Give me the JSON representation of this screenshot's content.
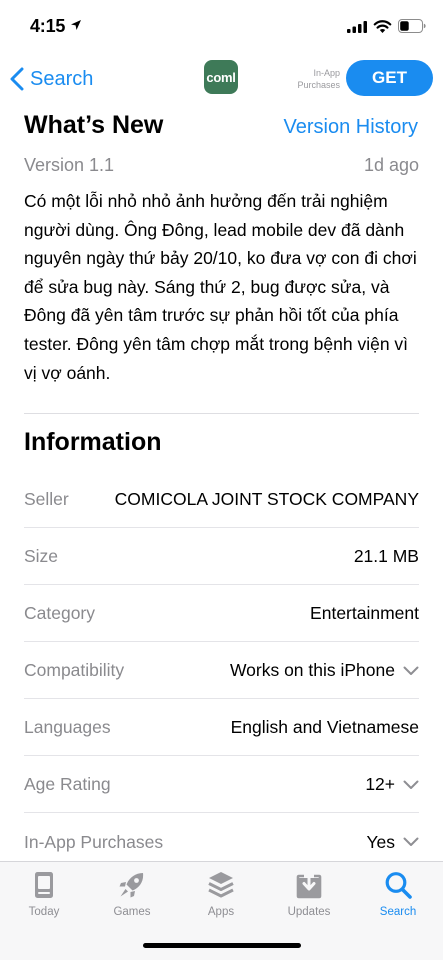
{
  "status_bar": {
    "time": "4:15"
  },
  "nav": {
    "back_label": "Search",
    "app_icon_text": "coml",
    "iap_label_1": "In-App",
    "iap_label_2": "Purchases",
    "get_label": "GET"
  },
  "whats_new": {
    "title": "What’s New",
    "version_history_label": "Version History",
    "version": "Version 1.1",
    "date": "1d ago",
    "notes": "Có một lỗi nhỏ nhỏ ảnh hưởng đến trải nghiệm người dùng. Ông Đông, lead mobile dev đã dành nguyên ngày thứ bảy 20/10, ko đưa vợ con đi chơi để sửa bug này. Sáng thứ 2, bug được sửa, và Đông đã yên tâm trước sự phản hồi tốt của phía tester. Đông yên tâm chợp mắt trong bệnh viện vì vị vợ oánh."
  },
  "information": {
    "title": "Information",
    "rows": [
      {
        "label": "Seller",
        "value": "COMICOLA JOINT STOCK COMPANY",
        "expandable": false
      },
      {
        "label": "Size",
        "value": "21.1 MB",
        "expandable": false
      },
      {
        "label": "Category",
        "value": "Entertainment",
        "expandable": false
      },
      {
        "label": "Compatibility",
        "value": "Works on this iPhone",
        "expandable": true
      },
      {
        "label": "Languages",
        "value": "English and Vietnamese",
        "expandable": false
      },
      {
        "label": "Age Rating",
        "value": "12+",
        "expandable": true
      },
      {
        "label": "In-App Purchases",
        "value": "Yes",
        "expandable": true
      }
    ]
  },
  "tab_bar": {
    "active": "Search",
    "tabs": [
      {
        "label": "Today",
        "icon": "today-icon"
      },
      {
        "label": "Games",
        "icon": "rocket-icon"
      },
      {
        "label": "Apps",
        "icon": "apps-stack-icon"
      },
      {
        "label": "Updates",
        "icon": "updates-download-icon"
      },
      {
        "label": "Search",
        "icon": "search-icon"
      }
    ]
  },
  "colors": {
    "accent": "#1a8cf0",
    "secondary_text": "#8a8a8e",
    "app_icon_bg": "#3e7a58",
    "tab_inactive": "#8e8e93"
  }
}
